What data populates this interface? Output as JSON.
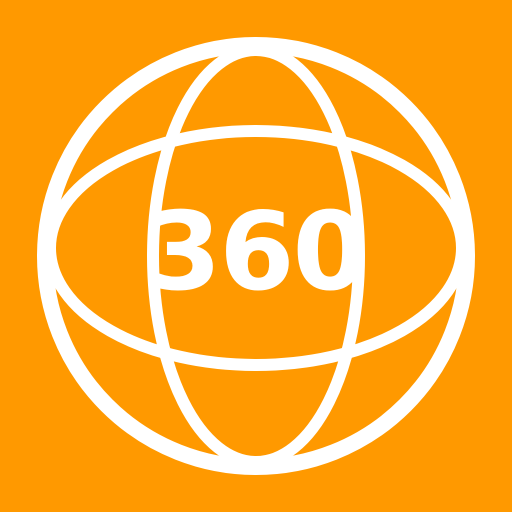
{
  "icon": {
    "label": "360",
    "symbol": "globe-icon",
    "background_color": "#FF9900",
    "foreground_color": "#FFFFFF"
  }
}
